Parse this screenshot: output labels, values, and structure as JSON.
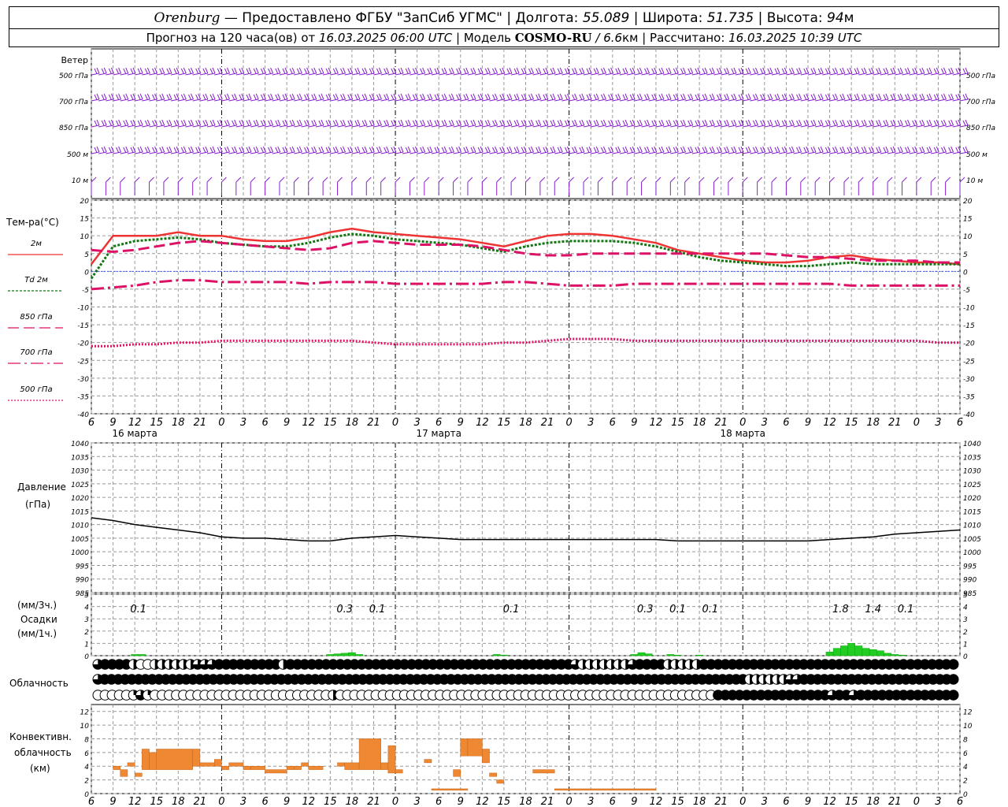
{
  "header": {
    "city": "Orenburg",
    "provider": " — Предоставлено ФГБУ \"ЗапСиб УГМС\" | ",
    "lon_label": "Долгота: ",
    "lon": "55.089",
    "lat_label": " | Широта: ",
    "lat": "51.735",
    "alt_label": " | Высота: ",
    "alt": "94",
    "alt_unit": "м",
    "forecast_label": "Прогноз на 120 часа(ов) от ",
    "forecast_from": "16.03.2025 06:00 UTC",
    "model_label": "  | Модель ",
    "model": "COSMO-RU",
    "model_res": " / 6.6",
    "model_res_unit": "км",
    "calc_label": " | Рассчитано: ",
    "calc_time": "16.03.2025 10:39 UTC"
  },
  "colors": {
    "t2m": "#ee3333",
    "td2m": "#117711",
    "t850": "#dd1166",
    "t700": "#dd1166",
    "t500": "#dd1166",
    "wind": "#8822cc",
    "pressure": "#000000",
    "precip": "#22cc22",
    "convective": "#ee8833",
    "grid": "#999999",
    "zero_line": "#3355ff"
  },
  "chart_data": [
    {
      "type": "wind_barbs",
      "title": "Ветер",
      "levels": [
        "500 гПа",
        "700 гПа",
        "850 гПа",
        "500 м",
        "10 м"
      ]
    },
    {
      "type": "line",
      "ylabel": "Тем-ра(°C)",
      "ylim": [
        -40,
        20
      ],
      "yticks": [
        -40,
        -35,
        -30,
        -25,
        -20,
        -15,
        -10,
        -5,
        0,
        5,
        10,
        15,
        20
      ],
      "legend": [
        {
          "key": "t2m",
          "label": "2м",
          "style": "solid"
        },
        {
          "key": "td2m",
          "label": "Td  2м",
          "style": "dotted"
        },
        {
          "key": "t850",
          "label": "850 гПа",
          "style": "dashed"
        },
        {
          "key": "t700",
          "label": "700 гПа",
          "style": "dashdot"
        },
        {
          "key": "t500",
          "label": "500 гПа",
          "style": "dotted-fine"
        }
      ],
      "x_hours": [
        0,
        3,
        6,
        9,
        12,
        15,
        18,
        21,
        24,
        27,
        30,
        33,
        36,
        39,
        42,
        45,
        48,
        51,
        54,
        57,
        60,
        63,
        66,
        69,
        72,
        75,
        78,
        81,
        84,
        87,
        90,
        93,
        96,
        99,
        102,
        105,
        108,
        111,
        114,
        117,
        120
      ],
      "series": [
        {
          "key": "t2m",
          "name": "2м",
          "values": [
            2,
            10,
            10,
            10,
            11,
            10,
            10,
            9,
            8.5,
            8.5,
            9.5,
            11,
            12,
            11,
            10.5,
            10,
            9.5,
            9,
            8,
            7,
            8.5,
            10,
            10.5,
            10.5,
            10,
            9,
            8,
            6,
            5,
            4,
            3,
            2.5,
            2.5,
            3,
            4,
            4.5,
            3.5,
            3,
            2.5,
            2.5,
            2
          ]
        },
        {
          "key": "td2m",
          "name": "Td 2м",
          "values": [
            -2,
            7,
            8.5,
            9,
            9.5,
            9,
            8,
            7.5,
            7,
            7,
            8,
            9.5,
            10.5,
            10,
            9,
            8.5,
            8,
            7.5,
            6.5,
            5.5,
            7,
            8,
            8.5,
            8.5,
            8.5,
            8,
            7,
            5.5,
            4,
            3,
            2.5,
            2,
            1.5,
            1.5,
            2,
            2.5,
            2,
            2,
            2,
            2,
            2
          ]
        },
        {
          "key": "t850",
          "name": "850 гПа",
          "values": [
            6,
            5.5,
            6,
            7,
            8,
            8.5,
            8,
            7.5,
            7,
            6.5,
            6,
            6.5,
            8,
            8.5,
            8,
            7.5,
            7.5,
            7.5,
            7,
            6,
            5,
            4.5,
            4.5,
            5,
            5,
            5,
            5,
            5,
            5,
            5,
            5,
            5,
            4.5,
            4,
            4,
            3.5,
            3,
            3,
            3,
            2.5,
            2.5
          ]
        },
        {
          "key": "t700",
          "name": "700 гПа",
          "values": [
            -5,
            -4.5,
            -4,
            -3,
            -2.5,
            -2.5,
            -3,
            -3,
            -3,
            -3,
            -3.5,
            -3,
            -3,
            -3,
            -3.5,
            -3.5,
            -3.5,
            -3.5,
            -3.5,
            -3,
            -3,
            -3.5,
            -4,
            -4,
            -4,
            -3.5,
            -3.5,
            -3.5,
            -3.5,
            -3.5,
            -3.5,
            -3.5,
            -3.5,
            -3.5,
            -3.5,
            -4,
            -4,
            -4,
            -4,
            -4,
            -4
          ]
        },
        {
          "key": "t500",
          "name": "500 гПа",
          "values": [
            -21,
            -21,
            -20.5,
            -20.5,
            -20,
            -20,
            -19.5,
            -19.5,
            -19.5,
            -19.5,
            -19.5,
            -19.5,
            -19.5,
            -20,
            -20.5,
            -20.5,
            -20.5,
            -20.5,
            -20.5,
            -20,
            -20,
            -19.5,
            -19,
            -19,
            -19,
            -19.5,
            -19.5,
            -19.5,
            -19.5,
            -19.5,
            -19.5,
            -19.5,
            -19.5,
            -19.5,
            -19.5,
            -19.5,
            -19.5,
            -19.5,
            -19.5,
            -20,
            -20
          ]
        }
      ]
    },
    {
      "type": "line",
      "title": "Давление",
      "ylabel": "(гПа)",
      "ylim": [
        985,
        1040
      ],
      "yticks": [
        985,
        990,
        995,
        1000,
        1005,
        1010,
        1015,
        1020,
        1025,
        1030,
        1035,
        1040
      ],
      "x_hours": [
        0,
        3,
        6,
        9,
        12,
        15,
        18,
        21,
        24,
        27,
        30,
        33,
        36,
        39,
        42,
        45,
        48,
        51,
        54,
        57,
        60,
        63,
        66,
        69,
        72,
        75,
        78,
        81,
        84,
        87,
        90,
        93,
        96,
        99,
        102,
        105,
        108,
        111,
        114,
        117,
        120
      ],
      "values": [
        1012.5,
        1011.5,
        1010,
        1009,
        1008,
        1007,
        1005.5,
        1005,
        1005,
        1004.5,
        1004,
        1004,
        1005,
        1005.5,
        1006,
        1005.5,
        1005,
        1004.5,
        1004.5,
        1004.5,
        1004.5,
        1004.5,
        1004.5,
        1004.5,
        1004.5,
        1004.5,
        1004.5,
        1004,
        1004,
        1004,
        1004,
        1004,
        1004,
        1004,
        1004.5,
        1005,
        1005.5,
        1006.5,
        1007,
        1007.5,
        1008
      ]
    },
    {
      "type": "bar",
      "title": "Осадки",
      "ylabel": "(мм/3ч.)",
      "ylabel2": "(мм/1ч.)",
      "ylim": [
        0,
        5
      ],
      "yticks": [
        0,
        1,
        2,
        3,
        4,
        5
      ],
      "totals": [
        {
          "hour": 6.5,
          "text": "0.1"
        },
        {
          "hour": 35,
          "text": "0.3"
        },
        {
          "hour": 39.5,
          "text": "0.1"
        },
        {
          "hour": 58,
          "text": "0.1"
        },
        {
          "hour": 76.5,
          "text": "0.3"
        },
        {
          "hour": 81,
          "text": "0.1"
        },
        {
          "hour": 85.5,
          "text": "0.1"
        },
        {
          "hour": 103.5,
          "text": "1.8"
        },
        {
          "hour": 108,
          "text": "1.4"
        },
        {
          "hour": 112.5,
          "text": "0.1"
        }
      ],
      "hourly": [
        {
          "hour": 6,
          "value": 0.1
        },
        {
          "hour": 7,
          "value": 0.1
        },
        {
          "hour": 33,
          "value": 0.1
        },
        {
          "hour": 34,
          "value": 0.15
        },
        {
          "hour": 35,
          "value": 0.2
        },
        {
          "hour": 36,
          "value": 0.25
        },
        {
          "hour": 37,
          "value": 0.1
        },
        {
          "hour": 56,
          "value": 0.1
        },
        {
          "hour": 57,
          "value": 0.05
        },
        {
          "hour": 75,
          "value": 0.1
        },
        {
          "hour": 76,
          "value": 0.25
        },
        {
          "hour": 77,
          "value": 0.15
        },
        {
          "hour": 80,
          "value": 0.1
        },
        {
          "hour": 81,
          "value": 0.05
        },
        {
          "hour": 84,
          "value": 0.05
        },
        {
          "hour": 102,
          "value": 0.3
        },
        {
          "hour": 103,
          "value": 0.6
        },
        {
          "hour": 104,
          "value": 0.8
        },
        {
          "hour": 105,
          "value": 1.0
        },
        {
          "hour": 106,
          "value": 0.8
        },
        {
          "hour": 107,
          "value": 0.6
        },
        {
          "hour": 108,
          "value": 0.5
        },
        {
          "hour": 109,
          "value": 0.4
        },
        {
          "hour": 110,
          "value": 0.2
        },
        {
          "hour": 111,
          "value": 0.1
        },
        {
          "hour": 112,
          "value": 0.05
        }
      ]
    },
    {
      "type": "heatmap",
      "title": "Облачность",
      "rows": [
        "0.75,1,1,1,1,0.5,0,0,0.5,0.5,0.5,0.5,0.5,0.5,0.75,0.75,0.75,1,1,1,1,1,1,1,1,1,0.5,1,1,1,1,1,1,1,1,1,1,1,1,1,1,1,1,1,1,1,1,1,1,1,1,1,1,1,1,1,1,1,1,1,1,1,1,1,1,1,1,0.75,0.5,0.5,0.5,0.5,0.5,0.5,0.5,0.75,1,1,1,1,0.5,0.5,0.5,0.5,0.5,1,1,1,1,1,1,1,1,1,1,1,1,1,1,1,1,1,1,1,1,1,1,1,1,1,1,1,1,1,1,1,1,1,1,1,1",
        "0.75,1,1,1,1,1,1,1,1,1,1,1,1,1,1,1,1,1,1,1,1,1,1,1,1,1,1,1,1,1,1,1,1,1,1,1,1,1,1,1,1,1,1,1,1,1,1,1,1,1,1,1,1,1,1,1,1,1,1,1,1,1,1,1,1,1,1,1,1,1,1,1,1,1,1,1,1,1,1,1,1,1,1,1,1,1,1,1,1,1,1,1,1,1,1,1,0.5,0.5,0.5,0.5,0.5,0.5,0.75,0.75,1,1,1,1,1,1,1,1,1,1,1,1,1,1,1,1,1,1,1,1,1,1,1",
        "0,0,0,0,0,0.25,0.75,0.25,0,0,0,0,0,0,0,0,0,0,0,0,0,0,0,0,0,0,0,0,0,0,0,0,0,0.5,0,0,0,0,0,0,0,0,0,0,0,0,0,0,0,0,0,0,0,0,0,0,0,0,0,0,0,0,0,0,0,0,0,0,0,0,0,0,0,0,0,0,0,0,0,0,0,0,0,0,0,0,0,1,1,1,1,1,1,1,1,1,1,1,1,1,1,1,1,0.75,1,1,0.75,1,1,1,1,1,1,1,1,1,1,1,1,1,1"
      ]
    },
    {
      "type": "bar",
      "title": "Конвективн.",
      "title2": "облачность",
      "ylabel": "(км)",
      "ylim": [
        0,
        13
      ],
      "yticks": [
        0,
        2,
        4,
        6,
        8,
        10,
        12
      ],
      "segments": [
        {
          "h0": 3,
          "h1": 4,
          "lo": 3.5,
          "hi": 4
        },
        {
          "h0": 4,
          "h1": 5,
          "lo": 2.5,
          "hi": 3.5
        },
        {
          "h0": 5,
          "h1": 6,
          "lo": 4,
          "hi": 4.5
        },
        {
          "h0": 6,
          "h1": 7,
          "lo": 2.5,
          "hi": 3
        },
        {
          "h0": 7,
          "h1": 8,
          "lo": 3.5,
          "hi": 6.5
        },
        {
          "h0": 8,
          "h1": 9,
          "lo": 3.5,
          "hi": 6
        },
        {
          "h0": 9,
          "h1": 14,
          "lo": 3.5,
          "hi": 6.5
        },
        {
          "h0": 14,
          "h1": 15,
          "lo": 4,
          "hi": 6.5
        },
        {
          "h0": 15,
          "h1": 17,
          "lo": 4,
          "hi": 4.5
        },
        {
          "h0": 17,
          "h1": 18,
          "lo": 4,
          "hi": 5
        },
        {
          "h0": 18,
          "h1": 19,
          "lo": 3.5,
          "hi": 4
        },
        {
          "h0": 19,
          "h1": 21,
          "lo": 4,
          "hi": 4.5
        },
        {
          "h0": 21,
          "h1": 22,
          "lo": 3.5,
          "hi": 4
        },
        {
          "h0": 22,
          "h1": 24,
          "lo": 3.5,
          "hi": 4
        },
        {
          "h0": 24,
          "h1": 27,
          "lo": 3,
          "hi": 3.5
        },
        {
          "h0": 27,
          "h1": 28,
          "lo": 3.5,
          "hi": 4
        },
        {
          "h0": 28,
          "h1": 29,
          "lo": 3.5,
          "hi": 4
        },
        {
          "h0": 29,
          "h1": 30,
          "lo": 4,
          "hi": 4.5
        },
        {
          "h0": 30,
          "h1": 32,
          "lo": 3.5,
          "hi": 4
        },
        {
          "h0": 34,
          "h1": 35,
          "lo": 4,
          "hi": 4.5
        },
        {
          "h0": 35,
          "h1": 37,
          "lo": 3.5,
          "hi": 4.5
        },
        {
          "h0": 37,
          "h1": 40,
          "lo": 3.5,
          "hi": 8
        },
        {
          "h0": 40,
          "h1": 41,
          "lo": 3.5,
          "hi": 4.5
        },
        {
          "h0": 41,
          "h1": 42,
          "lo": 3,
          "hi": 7
        },
        {
          "h0": 42,
          "h1": 43,
          "lo": 3,
          "hi": 3.5
        },
        {
          "h0": 46,
          "h1": 47,
          "lo": 4.5,
          "hi": 5
        },
        {
          "h0": 47,
          "h1": 52,
          "lo": 0.5,
          "hi": 0.7
        },
        {
          "h0": 50,
          "h1": 51,
          "lo": 2.5,
          "hi": 3.5
        },
        {
          "h0": 51,
          "h1": 52,
          "lo": 5.5,
          "hi": 8
        },
        {
          "h0": 52,
          "h1": 54,
          "lo": 5.5,
          "hi": 8
        },
        {
          "h0": 54,
          "h1": 55,
          "lo": 4.5,
          "hi": 6.5
        },
        {
          "h0": 55,
          "h1": 56,
          "lo": 2.5,
          "hi": 3
        },
        {
          "h0": 56,
          "h1": 57,
          "lo": 1.5,
          "hi": 2
        },
        {
          "h0": 61,
          "h1": 64,
          "lo": 3,
          "hi": 3.5
        },
        {
          "h0": 64,
          "h1": 78,
          "lo": 0.5,
          "hi": 0.7
        }
      ]
    }
  ],
  "x_axis": {
    "tick_hours": [
      0,
      3,
      6,
      9,
      12,
      15,
      18,
      21,
      24,
      27,
      30,
      33,
      36,
      39,
      42,
      45,
      48,
      51,
      54,
      57,
      60,
      63,
      66,
      69,
      72,
      75,
      78,
      81,
      84,
      87,
      90,
      93,
      96,
      99,
      102,
      105,
      108,
      111,
      114,
      117,
      120
    ],
    "tick_labels": [
      "6",
      "9",
      "12",
      "15",
      "18",
      "21",
      "0",
      "3",
      "6",
      "9",
      "12",
      "15",
      "18",
      "21",
      "0",
      "3",
      "6",
      "9",
      "12",
      "15",
      "18",
      "21",
      "0",
      "3",
      "6",
      "9",
      "12",
      "15",
      "18",
      "21",
      "0",
      "3",
      "6",
      "9",
      "12",
      "15",
      "18",
      "21",
      "0",
      "3",
      "6"
    ],
    "day_labels": [
      "16 марта",
      "17 марта",
      "18 марта"
    ],
    "midnight_hours": [
      18,
      42,
      66,
      90
    ]
  }
}
